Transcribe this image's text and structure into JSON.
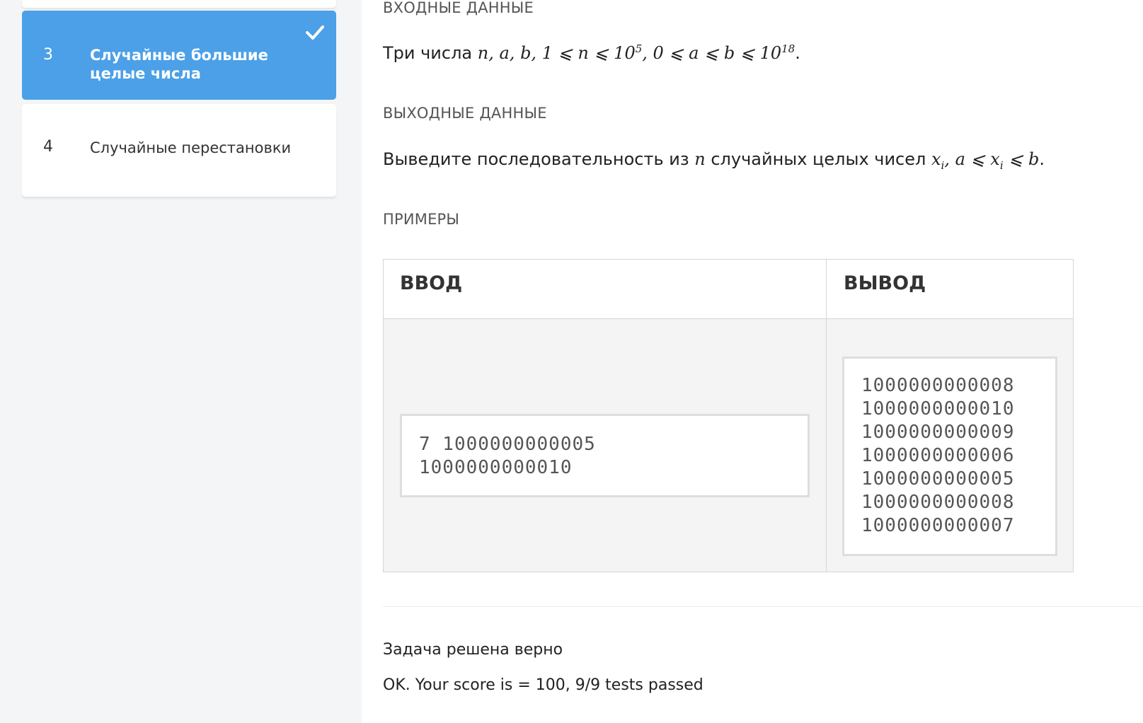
{
  "sidebar": {
    "items": [
      {
        "number": "3",
        "title": "Случайные большие целые числа",
        "state": "solved",
        "icon": "check-icon"
      },
      {
        "number": "4",
        "title": "Случайные перестановки",
        "state": "normal"
      }
    ]
  },
  "problem": {
    "input_heading": "ВХОДНЫЕ ДАННЫЕ",
    "input_text_prefix": "Три числа",
    "output_heading": "ВЫХОДНЫЕ ДАННЫЕ",
    "output_text_prefix": "Выведите последовательность из",
    "output_text_middle": "случайных целых чисел",
    "examples_heading": "ПРИМЕРЫ",
    "table": {
      "input_header": "ВВОД",
      "output_header": "ВЫВОД",
      "input_value": "7 1000000000005\n1000000000010",
      "output_value": "1000000000008\n1000000000010\n1000000000009\n1000000000006\n1000000000005\n1000000000008\n1000000000007"
    }
  },
  "result": {
    "verdict": "Задача решена верно",
    "details": "OK. Your score is = 100, 9/9 tests passed"
  },
  "colors": {
    "accent": "#4ba0e7",
    "sidebar_bg": "#f4f5f7"
  }
}
